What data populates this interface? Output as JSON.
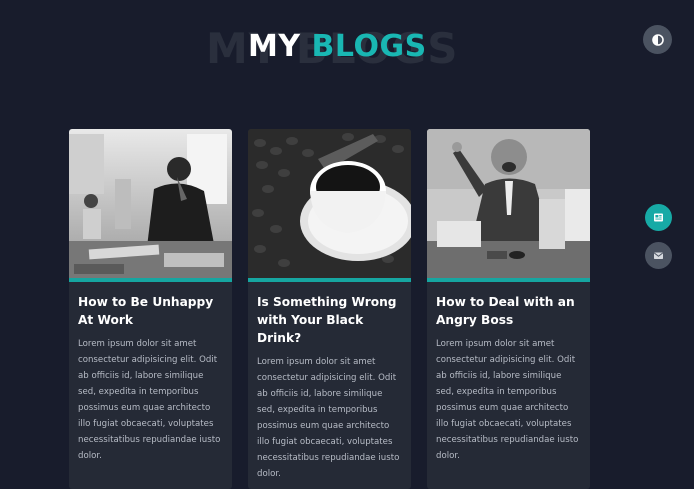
{
  "heading": {
    "shadow_text": "MY BLOGS",
    "title_word1": "MY",
    "title_word2": "BLOGS"
  },
  "colors": {
    "background": "#181c2c",
    "accent": "#19b7b3",
    "card": "#252a36",
    "icon_button": "#4b5361"
  },
  "icons": {
    "theme_toggle": "contrast-icon",
    "blog_button": "newspaper-icon",
    "mail_button": "envelope-icon"
  },
  "cards": [
    {
      "image": "man-stressed-at-desk-photo",
      "title": "How to Be Unhappy At Work",
      "text": "Lorem ipsum dolor sit amet consectetur adipisicing elit. Odit ab officiis id, labore similique sed, expedita in temporibus possimus eum quae architecto illo fugiat obcaecati, voluptates necessitatibus repudiandae iusto dolor."
    },
    {
      "image": "coffee-cup-with-beans-photo",
      "title": "Is Something Wrong with Your Black Drink?",
      "text": "Lorem ipsum dolor sit amet consectetur adipisicing elit. Odit ab officiis id, labore similique sed, expedita in temporibus possimus eum quae architecto illo fugiat obcaecati, voluptates necessitatibus repudiandae iusto dolor."
    },
    {
      "image": "angry-boss-pointing-photo",
      "title": "How to Deal with an Angry Boss",
      "text": "Lorem ipsum dolor sit amet consectetur adipisicing elit. Odit ab officiis id, labore similique sed, expedita in temporibus possimus eum quae architecto illo fugiat obcaecati, voluptates necessitatibus repudiandae iusto dolor."
    }
  ]
}
